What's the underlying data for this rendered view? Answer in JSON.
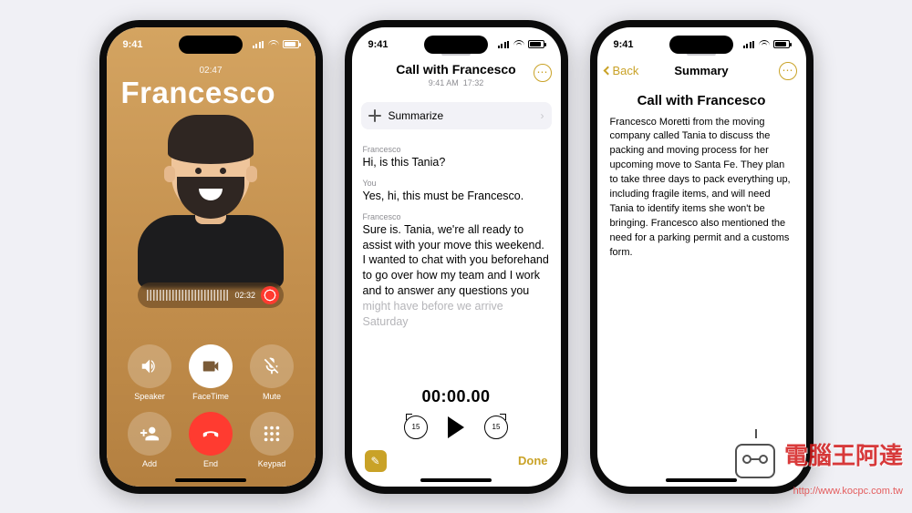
{
  "status": {
    "time": "9:41"
  },
  "call": {
    "duration": "02:47",
    "name": "Francesco",
    "rec_time": "02:32",
    "controls": {
      "speaker": "Speaker",
      "facetime": "FaceTime",
      "mute": "Mute",
      "add": "Add",
      "end": "End",
      "keypad": "Keypad"
    }
  },
  "note": {
    "title": "Call with Francesco",
    "meta_time": "9:41 AM",
    "meta_dur": "17:32",
    "summarize": "Summarize",
    "t1_speaker": "Francesco",
    "t1_text": "Hi, is this Tania?",
    "t2_speaker": "You",
    "t2_text": "Yes, hi, this must be Francesco.",
    "t3_speaker": "Francesco",
    "t3_text": "Sure is. Tania, we're all ready to assist with your move this weekend. I wanted to chat with you beforehand to go over how my team and I work and to answer any questions you",
    "t3_fade": "might have before we arrive Saturday",
    "player_time": "00:00.00",
    "skip": "15",
    "done": "Done"
  },
  "summary": {
    "back": "Back",
    "header": "Summary",
    "title": "Call with Francesco",
    "body": "Francesco Moretti from the moving company called Tania to discuss the packing and moving process for her upcoming move to Santa Fe. They plan to take three days to pack everything up, including fragile items, and will need Tania to identify items she won't be bringing. Francesco also mentioned the need for a parking permit and a customs form."
  },
  "watermark": {
    "title": "電腦王阿達",
    "url": "http://www.kocpc.com.tw"
  }
}
